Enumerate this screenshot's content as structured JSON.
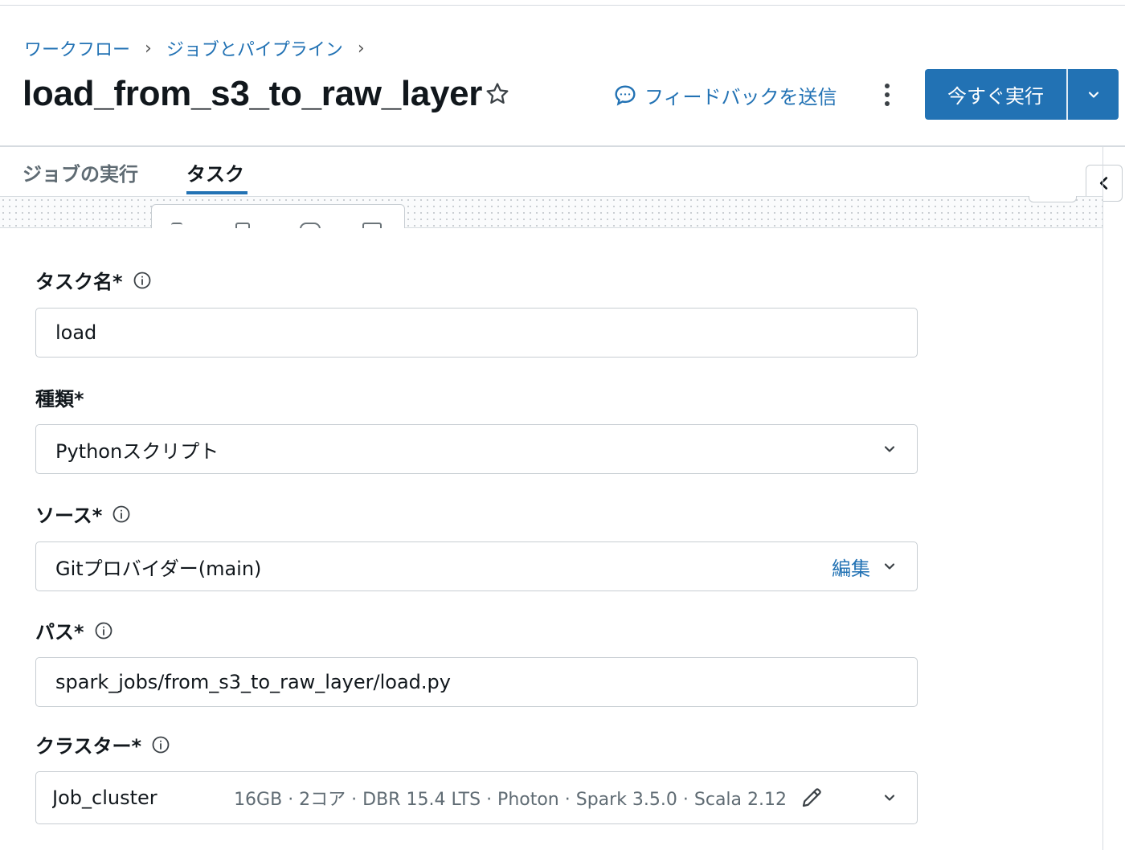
{
  "breadcrumb": {
    "items": [
      "ワークフロー",
      "ジョブとパイプライン"
    ],
    "separator": "›"
  },
  "header": {
    "title": "load_from_s3_to_raw_layer",
    "feedback_label": "フィードバックを送信",
    "run_now_label": "今すぐ実行"
  },
  "tabs": [
    {
      "label": "ジョブの実行",
      "active": false
    },
    {
      "label": "タスク",
      "active": true
    }
  ],
  "form": {
    "task_name": {
      "label": "タスク名*",
      "value": "load"
    },
    "type": {
      "label": "種類*",
      "value": "Pythonスクリプト"
    },
    "source": {
      "label": "ソース*",
      "value": "Gitプロバイダー(main)",
      "edit_label": "編集"
    },
    "path": {
      "label": "パス*",
      "value": "spark_jobs/from_s3_to_raw_layer/load.py"
    },
    "cluster": {
      "label": "クラスター*",
      "value": "Job_cluster",
      "meta": "16GB · 2コア · DBR 15.4 LTS · Photon · Spark 3.5.0 · Scala 2.12"
    }
  },
  "colors": {
    "accent": "#2272b4",
    "text": "#11171c",
    "muted": "#5f6b73",
    "border": "#c7cdd2"
  },
  "icons": [
    "star-icon",
    "speech-bubble-icon",
    "kebab-icon",
    "chevron-down-icon",
    "chevron-left-icon",
    "info-icon",
    "pencil-icon"
  ]
}
